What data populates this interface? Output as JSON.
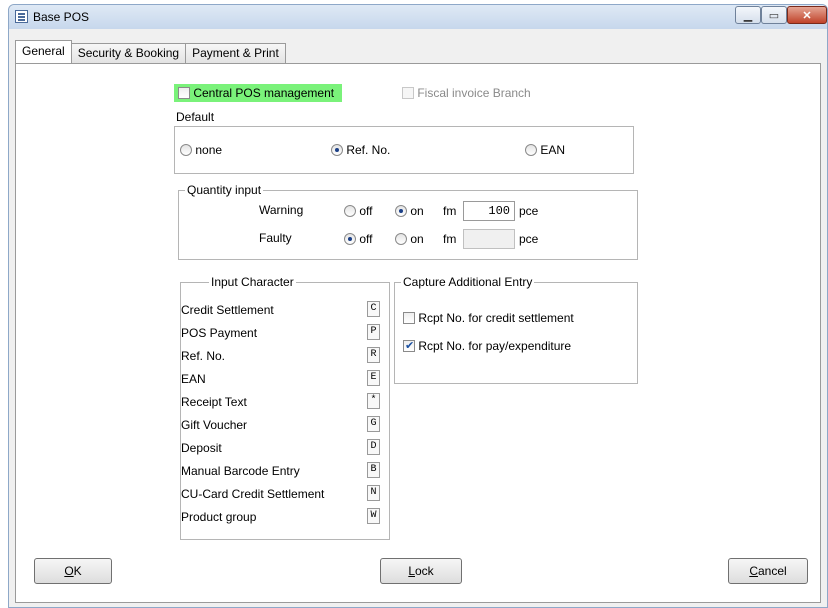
{
  "window": {
    "title": "Base POS",
    "min_icon": "minimize-icon",
    "max_icon": "maximize-icon",
    "close_icon": "close-icon"
  },
  "tabs": [
    {
      "label": "General",
      "active": true
    },
    {
      "label": "Security & Booking",
      "active": false
    },
    {
      "label": "Payment & Print",
      "active": false
    }
  ],
  "central_pos": {
    "label": "Central POS management",
    "checked": false,
    "highlight_color": "#7af27a"
  },
  "fiscal_invoice": {
    "label": "Fiscal invoice Branch",
    "checked": false,
    "enabled": false
  },
  "default_group": {
    "title": "Default",
    "options": [
      {
        "label": "none",
        "selected": false
      },
      {
        "label": "Ref. No.",
        "selected": true
      },
      {
        "label": "EAN",
        "selected": false
      }
    ]
  },
  "quantity": {
    "title": "Quantity input",
    "warning": {
      "label": "Warning",
      "off": "off",
      "on": "on",
      "fm": "fm",
      "value": "100",
      "unit": "pce",
      "selected": "on"
    },
    "faulty": {
      "label": "Faulty",
      "off": "off",
      "on": "on",
      "fm": "fm",
      "value": "",
      "unit": "pce",
      "selected": "off"
    }
  },
  "input_character": {
    "title": "Input Character",
    "items": [
      {
        "label": "Credit Settlement",
        "key": "C"
      },
      {
        "label": "POS Payment",
        "key": "P"
      },
      {
        "label": "Ref. No.",
        "key": "R"
      },
      {
        "label": "EAN",
        "key": "E"
      },
      {
        "label": "Receipt Text",
        "key": "*"
      },
      {
        "label": "Gift Voucher",
        "key": "G"
      },
      {
        "label": "Deposit",
        "key": "D"
      },
      {
        "label": "Manual Barcode Entry",
        "key": "B"
      },
      {
        "label": "CU-Card Credit Settlement",
        "key": "N"
      },
      {
        "label": "Product group",
        "key": "W"
      }
    ]
  },
  "capture": {
    "title": "Capture Additional Entry",
    "items": [
      {
        "label": "Rcpt No. for credit settlement",
        "checked": false
      },
      {
        "label": "Rcpt No. for pay/expenditure",
        "checked": true
      }
    ]
  },
  "buttons": {
    "ok_underlined": "O",
    "ok_rest": "K",
    "lock_underlined": "L",
    "lock_rest": "ock",
    "cancel_underlined": "C",
    "cancel_rest": "ancel"
  }
}
